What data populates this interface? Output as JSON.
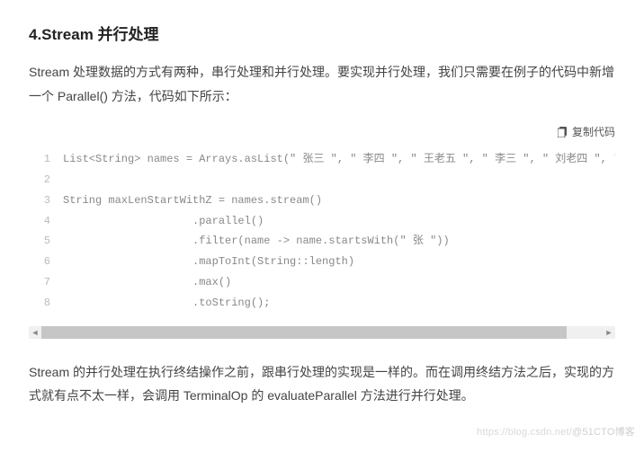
{
  "heading": "4.Stream 并行处理",
  "paragraph1": "Stream 处理数据的方式有两种，串行处理和并行处理。要实现并行处理，我们只需要在例子的代码中新增一个 Parallel() 方法，代码如下所示：",
  "copy_label": "复制代码",
  "code": {
    "lines": [
      "List<String> names = Arrays.asList(\" 张三 \", \" 李四 \", \" 王老五 \", \" 李三 \", \" 刘老四 \", \"",
      "",
      "String maxLenStartWithZ = names.stream()",
      "                    .parallel()",
      "                    .filter(name -> name.startsWith(\" 张 \"))",
      "                    .mapToInt(String::length)",
      "                    .max()",
      "                    .toString();"
    ]
  },
  "paragraph2": "Stream 的并行处理在执行终结操作之前，跟串行处理的实现是一样的。而在调用终结方法之后，实现的方式就有点不太一样，会调用 TerminalOp 的 evaluateParallel 方法进行并行处理。",
  "watermark_site": "https://blog.csdn.net/",
  "watermark_handle": "@51CTO博客"
}
